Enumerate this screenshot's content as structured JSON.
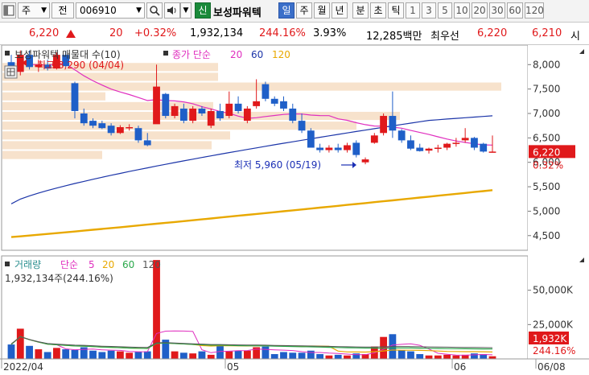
{
  "toolbar": {
    "type_label": "주",
    "market_label": "전",
    "code": "006910",
    "badge": "신",
    "stock_name": "보성파워텍",
    "periods": [
      "일",
      "주",
      "월",
      "년",
      "분",
      "초",
      "틱"
    ],
    "selected_period": "일",
    "intervals": [
      "1",
      "3",
      "5",
      "10",
      "20",
      "30",
      "60",
      "120"
    ]
  },
  "quote": {
    "price": "6,220",
    "change": "20",
    "change_pct": "+0.32%",
    "volume": "1,932,134",
    "volume_ratio": "244.16%",
    "turnover_rate": "3.93%",
    "trade_value": "12,285백만",
    "best_label": "최우선",
    "ask": "6,220",
    "bid": "6,210",
    "trailing": "시"
  },
  "price_panel": {
    "title": "보성파워텍 매물대 수(10)",
    "ma_label": "종가 단순",
    "ma_periods": [
      "20",
      "60",
      "120"
    ],
    "high_annotation": "최고 8,290 (04/04)",
    "low_annotation": "최저 5,960 (05/19)",
    "y_ticks": [
      "8,000",
      "7,500",
      "7,000",
      "6,500",
      "6,000",
      "5,500",
      "5,000",
      "4,500"
    ],
    "current_price": "6,220",
    "current_change": "0.32%"
  },
  "volume_panel": {
    "title": "거래량",
    "ma_label": "단순",
    "ma_periods": [
      "5",
      "20",
      "60",
      "120"
    ],
    "current_volume_text": "1,932,134주(244.16%)",
    "y_ticks": [
      "50,000K",
      "25,000K"
    ],
    "current_volume": "1,932K",
    "current_ratio": "244.16%"
  },
  "x_axis": [
    "2022/04",
    "05",
    "06",
    "06/08"
  ],
  "colors": {
    "up": "#e0191b",
    "down": "#1f5fc8",
    "ma20": "#e02fbf",
    "ma60": "#1b34a8",
    "ma120": "#e8a800",
    "volume_profile": "#f7e2cc",
    "badge": "#1a8a3a"
  },
  "chart_data": {
    "type": "candlestick",
    "price_range": [
      4200,
      8400
    ],
    "volume_range": [
      0,
      75000
    ],
    "candles": [
      {
        "o": 8050,
        "h": 8200,
        "l": 7800,
        "c": 7850,
        "v": 10500
      },
      {
        "o": 7850,
        "h": 8290,
        "l": 7780,
        "c": 8200,
        "v": 22000
      },
      {
        "o": 8200,
        "h": 8290,
        "l": 7900,
        "c": 7950,
        "v": 9500
      },
      {
        "o": 7950,
        "h": 8100,
        "l": 7850,
        "c": 8000,
        "v": 7000
      },
      {
        "o": 8000,
        "h": 8100,
        "l": 7880,
        "c": 7920,
        "v": 5000
      },
      {
        "o": 7920,
        "h": 8250,
        "l": 7900,
        "c": 8200,
        "v": 8000
      },
      {
        "o": 8200,
        "h": 8280,
        "l": 7950,
        "c": 7970,
        "v": 7000
      },
      {
        "o": 7620,
        "h": 7650,
        "l": 6900,
        "c": 7050,
        "v": 6500
      },
      {
        "o": 7000,
        "h": 7100,
        "l": 6750,
        "c": 6800,
        "v": 8500
      },
      {
        "o": 6850,
        "h": 6900,
        "l": 6700,
        "c": 6750,
        "v": 6000
      },
      {
        "o": 6800,
        "h": 6850,
        "l": 6680,
        "c": 6700,
        "v": 5000
      },
      {
        "o": 6750,
        "h": 6800,
        "l": 6550,
        "c": 6600,
        "v": 6000
      },
      {
        "o": 6600,
        "h": 6760,
        "l": 6580,
        "c": 6720,
        "v": 5500
      },
      {
        "o": 6700,
        "h": 6780,
        "l": 6650,
        "c": 6720,
        "v": 4500
      },
      {
        "o": 6700,
        "h": 6750,
        "l": 6400,
        "c": 6450,
        "v": 5000
      },
      {
        "o": 6450,
        "h": 6600,
        "l": 6330,
        "c": 6350,
        "v": 5500
      },
      {
        "o": 6780,
        "h": 8000,
        "l": 6800,
        "c": 7550,
        "v": 72000
      },
      {
        "o": 7400,
        "h": 7420,
        "l": 6900,
        "c": 6950,
        "v": 14000
      },
      {
        "o": 6950,
        "h": 7200,
        "l": 6900,
        "c": 7150,
        "v": 5500
      },
      {
        "o": 7100,
        "h": 7200,
        "l": 6800,
        "c": 6850,
        "v": 4500
      },
      {
        "o": 6850,
        "h": 7150,
        "l": 6800,
        "c": 7100,
        "v": 4000
      },
      {
        "o": 7100,
        "h": 7150,
        "l": 6950,
        "c": 7000,
        "v": 5500
      },
      {
        "o": 6750,
        "h": 7100,
        "l": 6700,
        "c": 7050,
        "v": 3000
      },
      {
        "o": 7050,
        "h": 7200,
        "l": 6850,
        "c": 6900,
        "v": 10000
      },
      {
        "o": 6950,
        "h": 7450,
        "l": 6900,
        "c": 7200,
        "v": 5500
      },
      {
        "o": 7200,
        "h": 7350,
        "l": 7000,
        "c": 7050,
        "v": 6000
      },
      {
        "o": 6850,
        "h": 7150,
        "l": 6800,
        "c": 7100,
        "v": 6000
      },
      {
        "o": 7150,
        "h": 7700,
        "l": 7100,
        "c": 7250,
        "v": 8500
      },
      {
        "o": 7600,
        "h": 7650,
        "l": 7250,
        "c": 7300,
        "v": 9000
      },
      {
        "o": 7300,
        "h": 7350,
        "l": 7150,
        "c": 7200,
        "v": 3500
      },
      {
        "o": 7250,
        "h": 7350,
        "l": 7050,
        "c": 7100,
        "v": 5000
      },
      {
        "o": 7100,
        "h": 7200,
        "l": 6800,
        "c": 6850,
        "v": 4500
      },
      {
        "o": 6850,
        "h": 7000,
        "l": 6600,
        "c": 6650,
        "v": 4500
      },
      {
        "o": 6650,
        "h": 6700,
        "l": 6300,
        "c": 6300,
        "v": 6000
      },
      {
        "o": 6300,
        "h": 6380,
        "l": 6200,
        "c": 6250,
        "v": 3500
      },
      {
        "o": 6250,
        "h": 6350,
        "l": 6200,
        "c": 6300,
        "v": 2500
      },
      {
        "o": 6300,
        "h": 6380,
        "l": 6200,
        "c": 6250,
        "v": 3000
      },
      {
        "o": 6250,
        "h": 6400,
        "l": 6200,
        "c": 6350,
        "v": 2500
      },
      {
        "o": 6400,
        "h": 6450,
        "l": 6100,
        "c": 6150,
        "v": 4000
      },
      {
        "o": 6000,
        "h": 6100,
        "l": 5960,
        "c": 6060,
        "v": 3500
      },
      {
        "o": 6400,
        "h": 6600,
        "l": 6380,
        "c": 6550,
        "v": 9000
      },
      {
        "o": 6600,
        "h": 7000,
        "l": 6550,
        "c": 6950,
        "v": 16000
      },
      {
        "o": 6950,
        "h": 7450,
        "l": 6500,
        "c": 6650,
        "v": 18000
      },
      {
        "o": 6650,
        "h": 6680,
        "l": 6400,
        "c": 6450,
        "v": 6500
      },
      {
        "o": 6450,
        "h": 6550,
        "l": 6250,
        "c": 6280,
        "v": 5500
      },
      {
        "o": 6300,
        "h": 6380,
        "l": 6220,
        "c": 6230,
        "v": 3500
      },
      {
        "o": 6240,
        "h": 6300,
        "l": 6180,
        "c": 6280,
        "v": 2500
      },
      {
        "o": 6280,
        "h": 6360,
        "l": 6200,
        "c": 6300,
        "v": 2500
      },
      {
        "o": 6300,
        "h": 6400,
        "l": 6250,
        "c": 6380,
        "v": 3000
      },
      {
        "o": 6380,
        "h": 6500,
        "l": 6320,
        "c": 6400,
        "v": 2500
      },
      {
        "o": 6450,
        "h": 6700,
        "l": 6400,
        "c": 6500,
        "v": 3000
      },
      {
        "o": 6500,
        "h": 6520,
        "l": 6250,
        "c": 6300,
        "v": 4000
      },
      {
        "o": 6380,
        "h": 6400,
        "l": 6200,
        "c": 6220,
        "v": 3500
      },
      {
        "o": 6200,
        "h": 6550,
        "l": 6200,
        "c": 6220,
        "v": 1932
      }
    ]
  }
}
